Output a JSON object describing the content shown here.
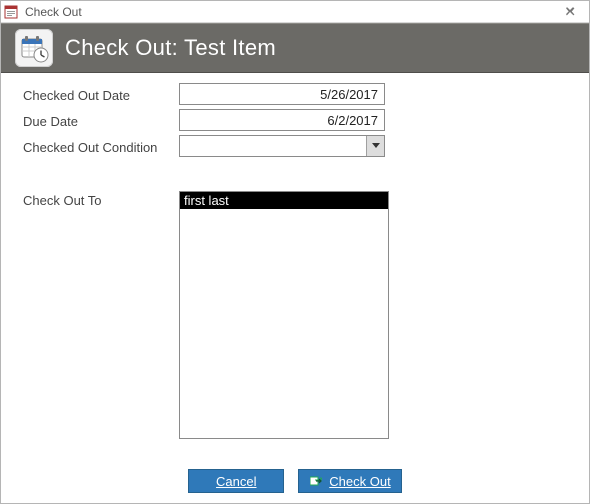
{
  "window": {
    "title": "Check Out"
  },
  "header": {
    "title": "Check Out: Test Item"
  },
  "form": {
    "checked_out_date": {
      "label": "Checked Out Date",
      "value": "5/26/2017"
    },
    "due_date": {
      "label": "Due Date",
      "value": "6/2/2017"
    },
    "condition": {
      "label": "Checked Out Condition",
      "value": ""
    },
    "check_out_to": {
      "label": "Check Out To",
      "items": [
        "first last"
      ],
      "selected_index": 0
    }
  },
  "buttons": {
    "cancel": "Cancel",
    "check_out": "Check Out"
  }
}
